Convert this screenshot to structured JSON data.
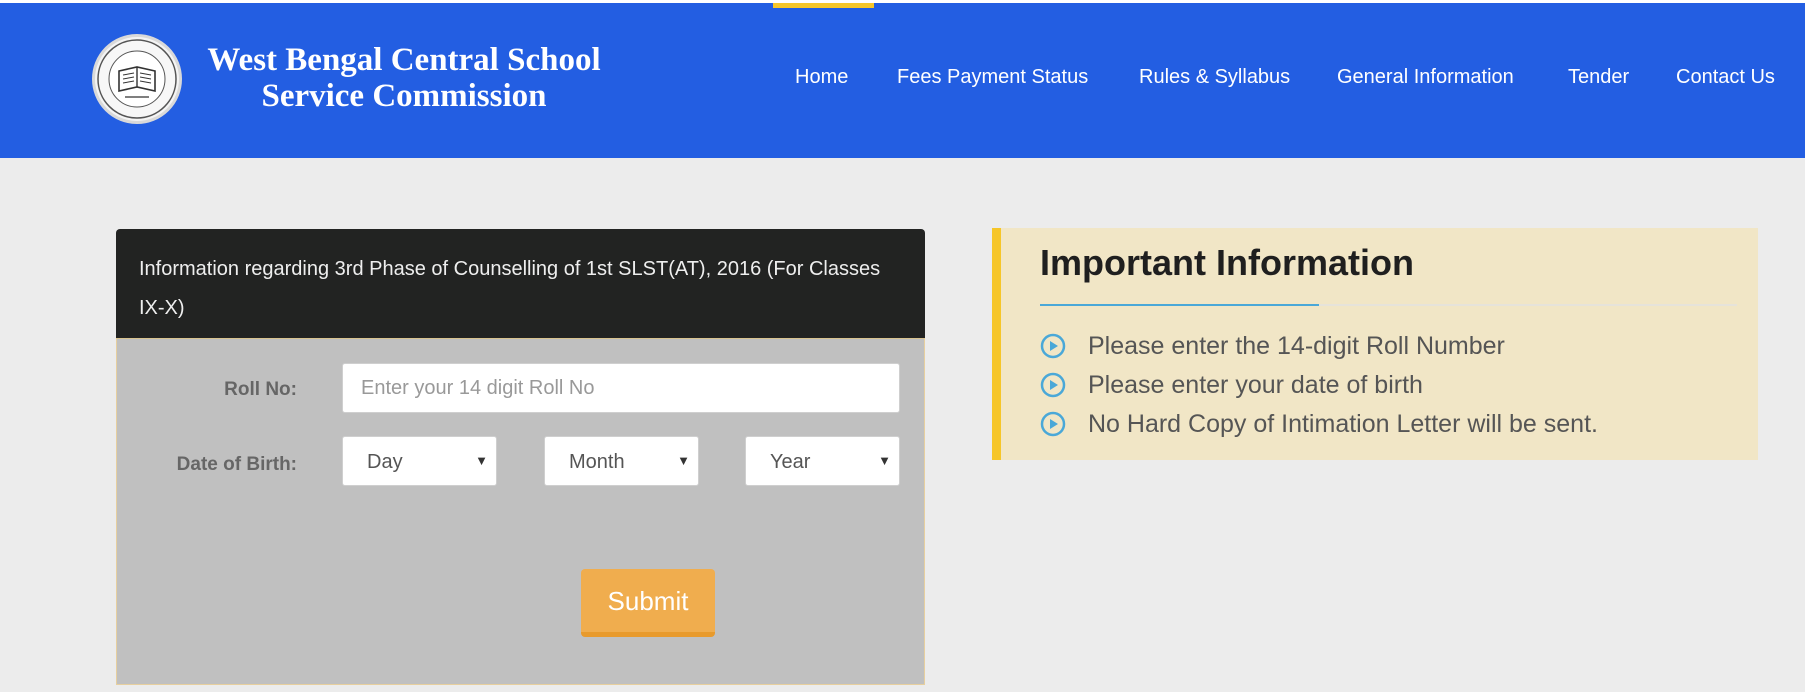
{
  "header": {
    "logo_line1": "West Bengal Central School",
    "logo_line2": "Service Commission",
    "nav": [
      {
        "label": "Home",
        "active": true
      },
      {
        "label": "Fees Payment Status"
      },
      {
        "label": "Rules & Syllabus"
      },
      {
        "label": "General Information"
      },
      {
        "label": "Tender"
      },
      {
        "label": "Contact Us"
      }
    ]
  },
  "form": {
    "title": "Information regarding 3rd Phase of Counselling of 1st SLST(AT), 2016 (For Classes IX-X)",
    "roll_label": "Roll No:",
    "roll_placeholder": "Enter your 14 digit Roll No",
    "dob_label": "Date of Birth:",
    "day": "Day",
    "month": "Month",
    "year": "Year",
    "submit": "Submit"
  },
  "info": {
    "title": "Important Information",
    "items": [
      "Please enter the 14-digit Roll Number",
      "Please enter your date of birth",
      "No Hard Copy of Intimation Letter will be sent."
    ]
  },
  "colors": {
    "header_bg": "#235ee2",
    "accent_yellow": "#f6c628",
    "submit_orange": "#f0ad4e",
    "icon_blue": "#4aa8d8"
  }
}
